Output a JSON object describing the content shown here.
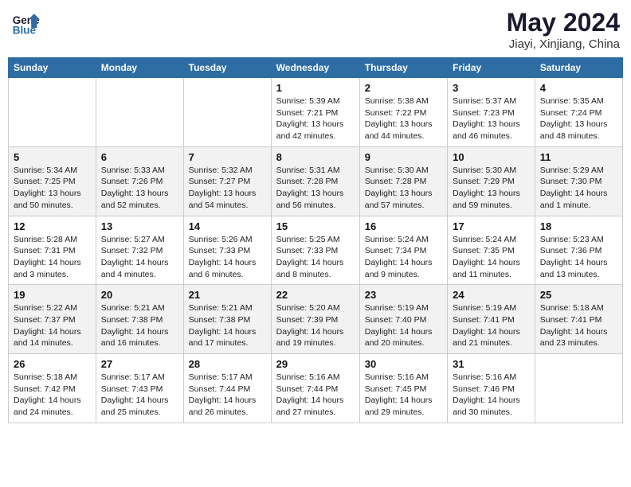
{
  "header": {
    "logo_line1": "General",
    "logo_line2": "Blue",
    "month_year": "May 2024",
    "location": "Jiayi, Xinjiang, China"
  },
  "weekdays": [
    "Sunday",
    "Monday",
    "Tuesday",
    "Wednesday",
    "Thursday",
    "Friday",
    "Saturday"
  ],
  "weeks": [
    [
      {
        "day": "",
        "sunrise": "",
        "sunset": "",
        "daylight": ""
      },
      {
        "day": "",
        "sunrise": "",
        "sunset": "",
        "daylight": ""
      },
      {
        "day": "",
        "sunrise": "",
        "sunset": "",
        "daylight": ""
      },
      {
        "day": "1",
        "sunrise": "Sunrise: 5:39 AM",
        "sunset": "Sunset: 7:21 PM",
        "daylight": "Daylight: 13 hours and 42 minutes."
      },
      {
        "day": "2",
        "sunrise": "Sunrise: 5:38 AM",
        "sunset": "Sunset: 7:22 PM",
        "daylight": "Daylight: 13 hours and 44 minutes."
      },
      {
        "day": "3",
        "sunrise": "Sunrise: 5:37 AM",
        "sunset": "Sunset: 7:23 PM",
        "daylight": "Daylight: 13 hours and 46 minutes."
      },
      {
        "day": "4",
        "sunrise": "Sunrise: 5:35 AM",
        "sunset": "Sunset: 7:24 PM",
        "daylight": "Daylight: 13 hours and 48 minutes."
      }
    ],
    [
      {
        "day": "5",
        "sunrise": "Sunrise: 5:34 AM",
        "sunset": "Sunset: 7:25 PM",
        "daylight": "Daylight: 13 hours and 50 minutes."
      },
      {
        "day": "6",
        "sunrise": "Sunrise: 5:33 AM",
        "sunset": "Sunset: 7:26 PM",
        "daylight": "Daylight: 13 hours and 52 minutes."
      },
      {
        "day": "7",
        "sunrise": "Sunrise: 5:32 AM",
        "sunset": "Sunset: 7:27 PM",
        "daylight": "Daylight: 13 hours and 54 minutes."
      },
      {
        "day": "8",
        "sunrise": "Sunrise: 5:31 AM",
        "sunset": "Sunset: 7:28 PM",
        "daylight": "Daylight: 13 hours and 56 minutes."
      },
      {
        "day": "9",
        "sunrise": "Sunrise: 5:30 AM",
        "sunset": "Sunset: 7:28 PM",
        "daylight": "Daylight: 13 hours and 57 minutes."
      },
      {
        "day": "10",
        "sunrise": "Sunrise: 5:30 AM",
        "sunset": "Sunset: 7:29 PM",
        "daylight": "Daylight: 13 hours and 59 minutes."
      },
      {
        "day": "11",
        "sunrise": "Sunrise: 5:29 AM",
        "sunset": "Sunset: 7:30 PM",
        "daylight": "Daylight: 14 hours and 1 minute."
      }
    ],
    [
      {
        "day": "12",
        "sunrise": "Sunrise: 5:28 AM",
        "sunset": "Sunset: 7:31 PM",
        "daylight": "Daylight: 14 hours and 3 minutes."
      },
      {
        "day": "13",
        "sunrise": "Sunrise: 5:27 AM",
        "sunset": "Sunset: 7:32 PM",
        "daylight": "Daylight: 14 hours and 4 minutes."
      },
      {
        "day": "14",
        "sunrise": "Sunrise: 5:26 AM",
        "sunset": "Sunset: 7:33 PM",
        "daylight": "Daylight: 14 hours and 6 minutes."
      },
      {
        "day": "15",
        "sunrise": "Sunrise: 5:25 AM",
        "sunset": "Sunset: 7:33 PM",
        "daylight": "Daylight: 14 hours and 8 minutes."
      },
      {
        "day": "16",
        "sunrise": "Sunrise: 5:24 AM",
        "sunset": "Sunset: 7:34 PM",
        "daylight": "Daylight: 14 hours and 9 minutes."
      },
      {
        "day": "17",
        "sunrise": "Sunrise: 5:24 AM",
        "sunset": "Sunset: 7:35 PM",
        "daylight": "Daylight: 14 hours and 11 minutes."
      },
      {
        "day": "18",
        "sunrise": "Sunrise: 5:23 AM",
        "sunset": "Sunset: 7:36 PM",
        "daylight": "Daylight: 14 hours and 13 minutes."
      }
    ],
    [
      {
        "day": "19",
        "sunrise": "Sunrise: 5:22 AM",
        "sunset": "Sunset: 7:37 PM",
        "daylight": "Daylight: 14 hours and 14 minutes."
      },
      {
        "day": "20",
        "sunrise": "Sunrise: 5:21 AM",
        "sunset": "Sunset: 7:38 PM",
        "daylight": "Daylight: 14 hours and 16 minutes."
      },
      {
        "day": "21",
        "sunrise": "Sunrise: 5:21 AM",
        "sunset": "Sunset: 7:38 PM",
        "daylight": "Daylight: 14 hours and 17 minutes."
      },
      {
        "day": "22",
        "sunrise": "Sunrise: 5:20 AM",
        "sunset": "Sunset: 7:39 PM",
        "daylight": "Daylight: 14 hours and 19 minutes."
      },
      {
        "day": "23",
        "sunrise": "Sunrise: 5:19 AM",
        "sunset": "Sunset: 7:40 PM",
        "daylight": "Daylight: 14 hours and 20 minutes."
      },
      {
        "day": "24",
        "sunrise": "Sunrise: 5:19 AM",
        "sunset": "Sunset: 7:41 PM",
        "daylight": "Daylight: 14 hours and 21 minutes."
      },
      {
        "day": "25",
        "sunrise": "Sunrise: 5:18 AM",
        "sunset": "Sunset: 7:41 PM",
        "daylight": "Daylight: 14 hours and 23 minutes."
      }
    ],
    [
      {
        "day": "26",
        "sunrise": "Sunrise: 5:18 AM",
        "sunset": "Sunset: 7:42 PM",
        "daylight": "Daylight: 14 hours and 24 minutes."
      },
      {
        "day": "27",
        "sunrise": "Sunrise: 5:17 AM",
        "sunset": "Sunset: 7:43 PM",
        "daylight": "Daylight: 14 hours and 25 minutes."
      },
      {
        "day": "28",
        "sunrise": "Sunrise: 5:17 AM",
        "sunset": "Sunset: 7:44 PM",
        "daylight": "Daylight: 14 hours and 26 minutes."
      },
      {
        "day": "29",
        "sunrise": "Sunrise: 5:16 AM",
        "sunset": "Sunset: 7:44 PM",
        "daylight": "Daylight: 14 hours and 27 minutes."
      },
      {
        "day": "30",
        "sunrise": "Sunrise: 5:16 AM",
        "sunset": "Sunset: 7:45 PM",
        "daylight": "Daylight: 14 hours and 29 minutes."
      },
      {
        "day": "31",
        "sunrise": "Sunrise: 5:16 AM",
        "sunset": "Sunset: 7:46 PM",
        "daylight": "Daylight: 14 hours and 30 minutes."
      },
      {
        "day": "",
        "sunrise": "",
        "sunset": "",
        "daylight": ""
      }
    ]
  ]
}
